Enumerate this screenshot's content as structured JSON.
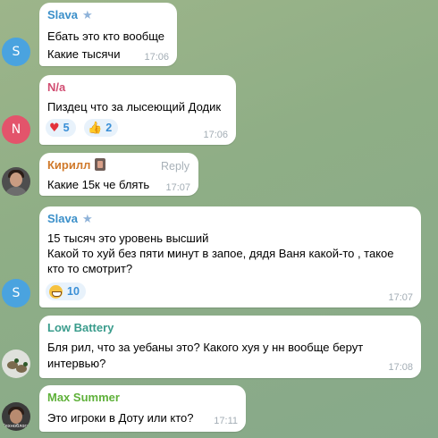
{
  "messages": [
    {
      "author": "Slava",
      "author_color": "#3a8fc9",
      "avatar_letter": "S",
      "avatar_color": "#4aa3df",
      "lines": [
        "Ебать это кто вообще",
        "Какие тысячи"
      ],
      "time": "17:06"
    },
    {
      "author": "N/a",
      "author_color": "#d14d72",
      "avatar_letter": "N",
      "avatar_color": "#e3546b",
      "lines": [
        "Пиздец что за лысеющий Додик"
      ],
      "reactions": [
        {
          "emoji": "♥",
          "icon": "heart-icon",
          "count": "5"
        },
        {
          "emoji": "👍",
          "icon": "thumbs-up-icon",
          "count": "2"
        }
      ],
      "time": "17:06"
    },
    {
      "author": "Кирилл",
      "author_color": "#d0792a",
      "avatar_icon": "user-photo",
      "reply_label": "Reply",
      "lines": [
        "Какие 15к че блять"
      ],
      "time": "17:07"
    },
    {
      "author": "Slava",
      "author_color": "#3a8fc9",
      "avatar_letter": "S",
      "avatar_color": "#4aa3df",
      "lines": [
        "15 тысяч это уровень высший",
        "Какой то хуй без пяти минут в запое, дядя Ваня какой-то , такое",
        "кто то смотрит?"
      ],
      "reactions": [
        {
          "emoji": "😁",
          "icon": "grin-icon",
          "count": "10"
        }
      ],
      "time": "17:07"
    },
    {
      "author": "Low Battery",
      "author_color": "#3a9c8c",
      "avatar_icon": "ducks-photo",
      "lines": [
        "Бля рил, что за уебаны это? Какого хуя у нн вообще берут",
        "интервью?"
      ],
      "time": "17:08"
    },
    {
      "author": "Max Summer",
      "author_color": "#5fb13a",
      "avatar_icon": "user-photo",
      "avatar_caption": "Техноблоги",
      "lines": [
        "Это игроки в Доту или кто?"
      ],
      "time": "17:11"
    }
  ]
}
